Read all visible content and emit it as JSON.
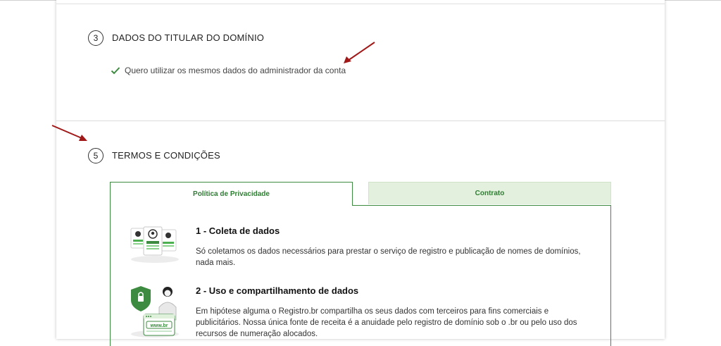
{
  "section3": {
    "number": "3",
    "title": "DADOS DO TITULAR DO DOMÍNIO",
    "checkbox_label": "Quero utilizar os mesmos dados do administrador da conta"
  },
  "section5": {
    "number": "5",
    "title": "TERMOS E CONDIÇÕES",
    "tabs": [
      {
        "label": "Política de Privacidade"
      },
      {
        "label": "Contrato"
      }
    ],
    "items": [
      {
        "title": "1 - Coleta de dados",
        "body": "Só coletamos os dados necessários para prestar o serviço de registro e publicação de nomes de domínios, nada mais."
      },
      {
        "title": "2 - Uso e compartilhamento de dados",
        "body": "Em hipótese alguma o Registro.br compartilha os seus dados com terceiros para fins comerciais e publicitários. Nossa única fonte de receita é a anuidade pelo registro de domínio sob o .br ou pelo uso dos recursos de numeração alocados."
      }
    ],
    "illustration_text": "www.br"
  },
  "colors": {
    "accent_green": "#3d8b40",
    "tab_inactive_bg": "#e3f0dd",
    "annotation_arrow": "#a01818"
  }
}
